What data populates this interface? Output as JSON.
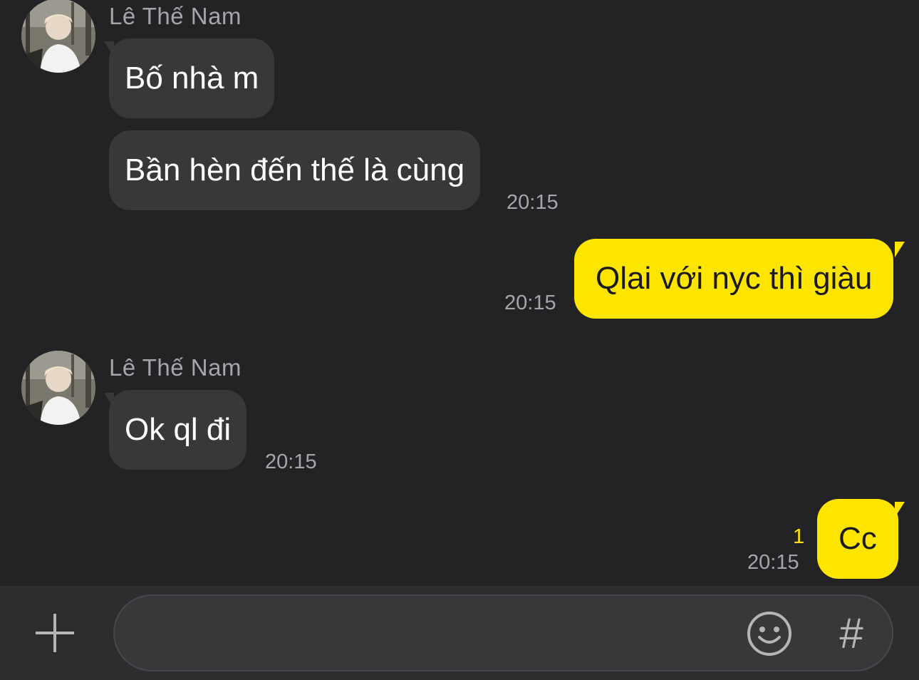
{
  "messages": [
    {
      "sender": "Lê Thế Nam",
      "text": "Bố nhà m"
    },
    {
      "text": "Bần hèn đến thế là cùng",
      "time": "20:15"
    },
    {
      "text": "Qlai với nyc thì giàu",
      "time": "20:15"
    },
    {
      "sender": "Lê Thế Nam",
      "text": "Ok ql đi",
      "time": "20:15"
    },
    {
      "text": "Cc",
      "time": "20:15",
      "unread_count": "1"
    }
  ],
  "composer": {
    "input_value": "",
    "plus_icon": "plus-icon",
    "emoji_icon": "emoji-icon",
    "hash_label": "#"
  },
  "colors": {
    "background": "#232325",
    "incoming_bubble": "#38383b",
    "outgoing_bubble": "#fee500",
    "timestamp": "#a6a6aa",
    "unread": "#fee500"
  }
}
